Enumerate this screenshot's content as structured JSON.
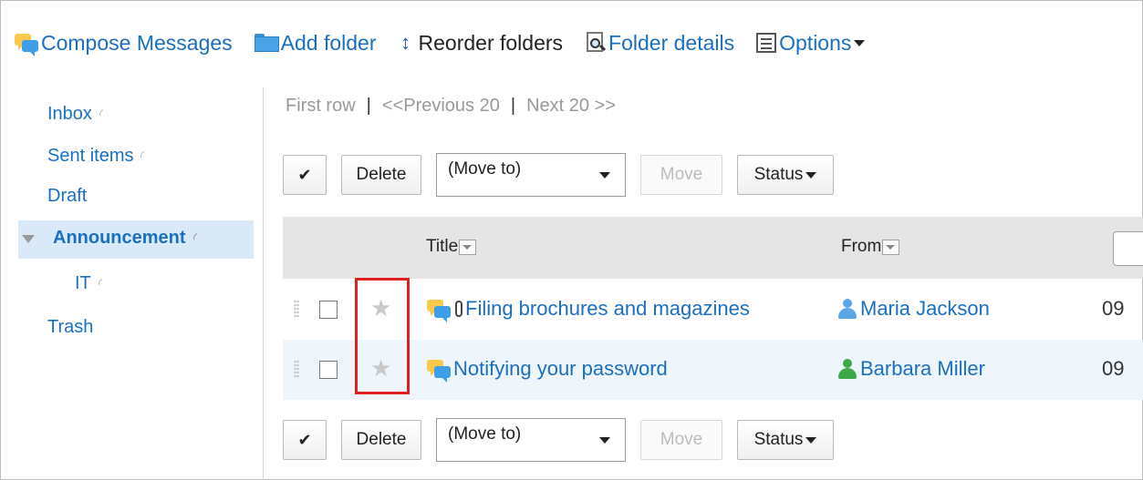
{
  "toolbar": {
    "compose": "Compose Messages",
    "add_folder": "Add folder",
    "reorder": "Reorder folders",
    "details": "Folder details",
    "options": "Options"
  },
  "sidebar": {
    "items": [
      {
        "label": "Inbox",
        "rss": true
      },
      {
        "label": "Sent items",
        "rss": true
      },
      {
        "label": "Draft",
        "rss": false
      },
      {
        "label": "Announcement",
        "rss": true,
        "selected": true
      },
      {
        "label": "IT",
        "rss": true
      },
      {
        "label": "Trash",
        "rss": false
      }
    ]
  },
  "pager": {
    "first": "First row",
    "prev": "<<Previous 20",
    "next": "Next 20 >>",
    "separator": "|"
  },
  "actions": {
    "check": "✔",
    "delete": "Delete",
    "move_to": "(Move to)",
    "move": "Move",
    "status": "Status"
  },
  "table": {
    "columns": {
      "title": "Title",
      "from": "From"
    },
    "rows": [
      {
        "title": "Filing brochures and magazines",
        "attachment": true,
        "from": "Maria Jackson",
        "from_color": "blue",
        "date": "09"
      },
      {
        "title": "Notifying your password",
        "attachment": false,
        "from": "Barbara Miller",
        "from_color": "green",
        "date": "09"
      }
    ]
  },
  "colors": {
    "link": "#1a6fc0",
    "selected_bg": "#d9e9f8",
    "header_bg": "#e5e5e5",
    "alt_row_bg": "#eef5fb",
    "highlight": "#e02020"
  }
}
